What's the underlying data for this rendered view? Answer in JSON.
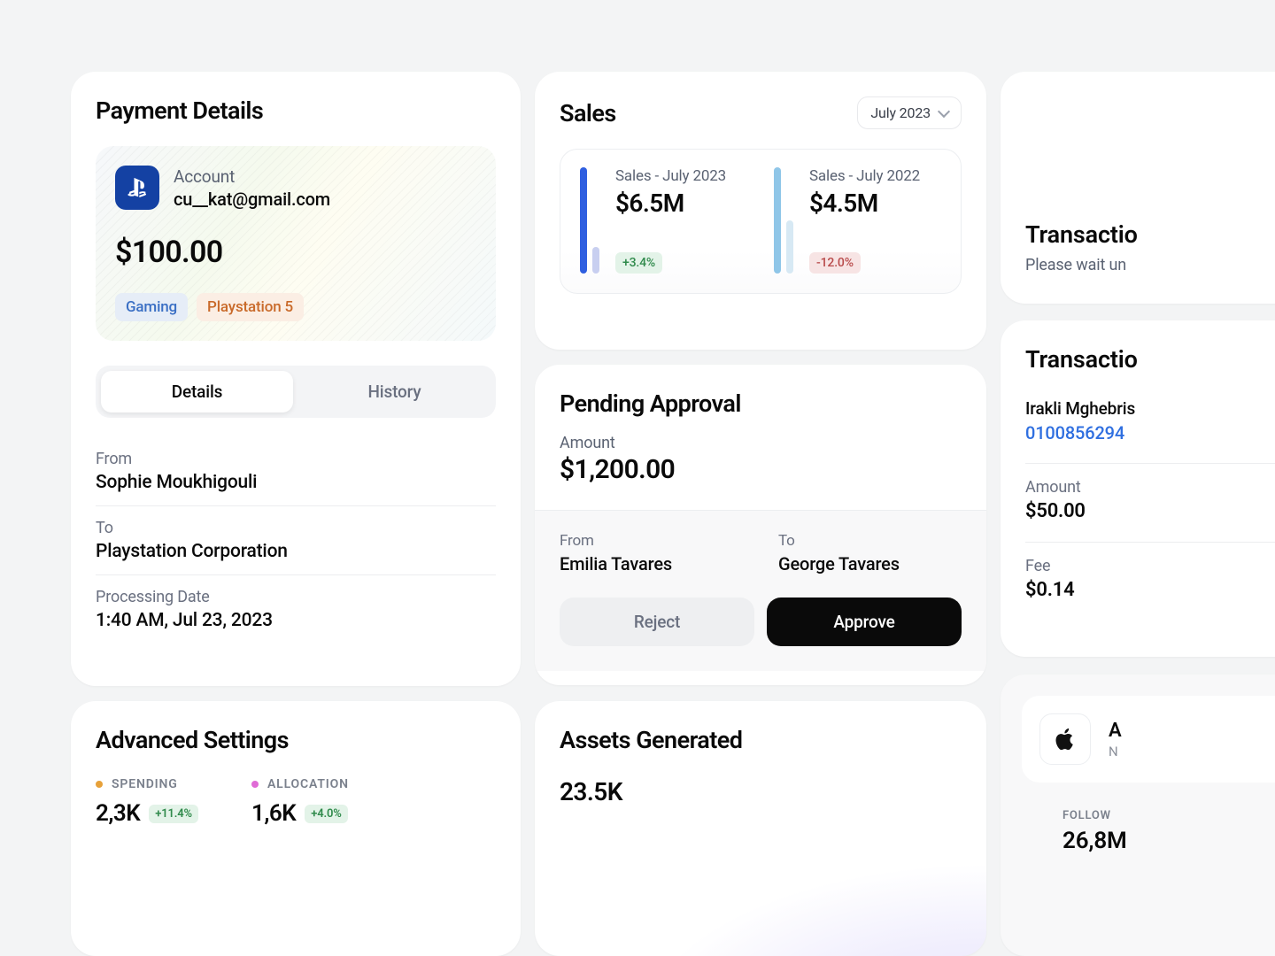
{
  "payment": {
    "title": "Payment Details",
    "account_label": "Account",
    "account_value": "cu__kat@gmail.com",
    "amount": "$100.00",
    "chips": {
      "gaming": "Gaming",
      "ps5": "Playstation 5"
    },
    "tabs": {
      "details": "Details",
      "history": "History"
    },
    "from_label": "From",
    "from_value": "Sophie Moukhigouli",
    "to_label": "To",
    "to_value": "Playstation Corporation",
    "date_label": "Processing Date",
    "date_value": "1:40 AM, Jul 23, 2023",
    "logo_name": "playstation-icon"
  },
  "sales": {
    "title": "Sales",
    "period": "July 2023",
    "m1": {
      "label": "Sales - July 2023",
      "value": "$6.5M",
      "delta": "+3.4%"
    },
    "m2": {
      "label": "Sales - July 2022",
      "value": "$4.5M",
      "delta": "-12.0%"
    }
  },
  "pending": {
    "title": "Pending Approval",
    "amount_label": "Amount",
    "amount": "$1,200.00",
    "from_label": "From",
    "from_value": "Emilia Tavares",
    "to_label": "To",
    "to_value": "George Tavares",
    "reject": "Reject",
    "approve": "Approve"
  },
  "advanced": {
    "title": "Advanced Settings",
    "spending_label": "SPENDING",
    "spending_value": "2,3K",
    "spending_delta": "+11.4%",
    "allocation_label": "ALLOCATION",
    "allocation_value": "1,6K",
    "allocation_delta": "+4.0%"
  },
  "assets": {
    "title": "Assets Generated",
    "value": "23.5K"
  },
  "edge1": {
    "title": "Transactio",
    "subtitle": "Please wait un"
  },
  "edge2": {
    "title": "Transactio",
    "name": "Irakli Mghebris",
    "link": "0100856294",
    "amount_label": "Amount",
    "amount_value": "$50.00",
    "fee_label": "Fee",
    "fee_value": "$0.14"
  },
  "edge3": {
    "brand_initial": "A",
    "brand_sub": "N",
    "follow_label": "FOLLOW",
    "follow_value": "26,8M"
  },
  "chart_data": {
    "type": "bar",
    "series": [
      {
        "name": "Sales - July 2023",
        "value_label": "$6.5M",
        "value": 6.5,
        "delta_pct": 3.4
      },
      {
        "name": "Sales - July 2022",
        "value_label": "$4.5M",
        "value": 4.5,
        "delta_pct": -12.0
      }
    ],
    "unit": "million USD",
    "title": "Sales",
    "period": "July 2023"
  }
}
